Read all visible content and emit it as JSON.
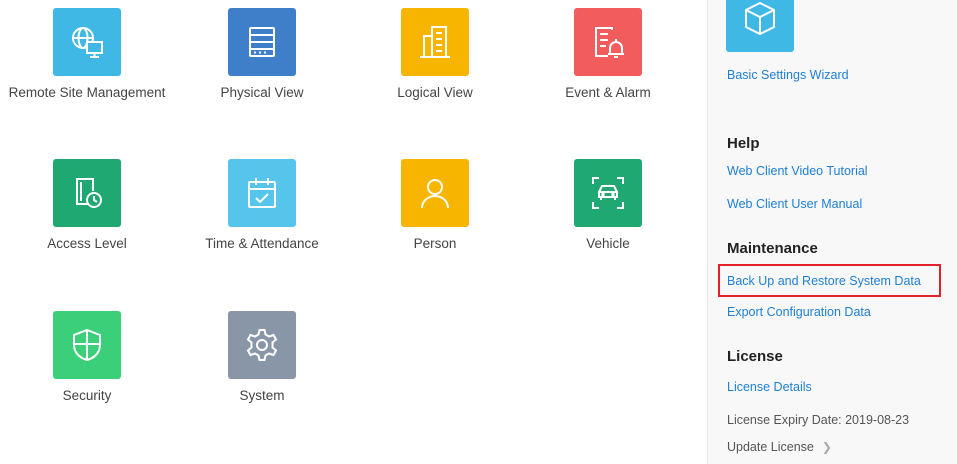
{
  "modules": [
    {
      "label": "Remote Site Management",
      "icon": "globe-monitor-icon",
      "color": "#3fb8e6"
    },
    {
      "label": "Physical View",
      "icon": "server-rack-icon",
      "color": "#3f7ec9"
    },
    {
      "label": "Logical View",
      "icon": "building-icon",
      "color": "#f7b500"
    },
    {
      "label": "Event & Alarm",
      "icon": "alarm-bell-icon",
      "color": "#f25c5c"
    },
    {
      "label": "Access Level",
      "icon": "door-clock-icon",
      "color": "#1fa872"
    },
    {
      "label": "Time & Attendance",
      "icon": "calendar-check-icon",
      "color": "#55c5ec"
    },
    {
      "label": "Person",
      "icon": "person-icon",
      "color": "#f7b500"
    },
    {
      "label": "Vehicle",
      "icon": "vehicle-scan-icon",
      "color": "#1fa872"
    },
    {
      "label": "Security",
      "icon": "shield-icon",
      "color": "#3ccf7a"
    },
    {
      "label": "System",
      "icon": "gear-icon",
      "color": "#8896a8"
    }
  ],
  "sidebar": {
    "wizard": {
      "label": "Basic Settings Wizard",
      "icon": "cube-icon",
      "color": "#3fb8e6"
    },
    "help": {
      "title": "Help",
      "links": [
        "Web Client Video Tutorial",
        "Web Client User Manual"
      ]
    },
    "maintenance": {
      "title": "Maintenance",
      "links": [
        "Back Up and Restore System Data",
        "Export Configuration Data"
      ]
    },
    "license": {
      "title": "License",
      "details_link": "License Details",
      "expiry": "License Expiry Date: 2019-08-23",
      "update": "Update License"
    },
    "highlight_color": "#e3212b"
  }
}
